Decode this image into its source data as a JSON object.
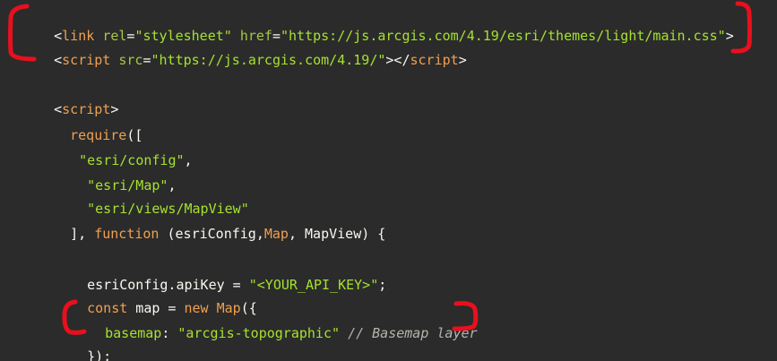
{
  "code": {
    "line1": {
      "open": "<",
      "tag": "link",
      "attr1": "rel",
      "eq1": "=",
      "val1": "\"stylesheet\"",
      "attr2": "href",
      "eq2": "=",
      "val2": "\"https://js.arcgis.com/4.19/esri/themes/light/main.css\"",
      "close": ">"
    },
    "line2": {
      "open": "<",
      "tag": "script",
      "attr1": "src",
      "eq1": "=",
      "val1": "\"https://js.arcgis.com/4.19/\"",
      "mid": "></",
      "tag2": "script",
      "close": ">"
    },
    "line4": {
      "open": "<",
      "tag": "script",
      "close": ">"
    },
    "line5": {
      "fn": "require",
      "punct": "(["
    },
    "line6": {
      "str": "\"esri/config\"",
      "punct": ","
    },
    "line7": {
      "str": "\"esri/Map\"",
      "punct": ","
    },
    "line8": {
      "str": "\"esri/views/MapView\""
    },
    "line9": {
      "p1": "], ",
      "kw": "function",
      "p2": " (esriConfig,",
      "map": "Map",
      "p3": ", MapView) {"
    },
    "line11": {
      "p1": "esriConfig.apiKey = ",
      "str": "\"<YOUR_API_KEY>\"",
      "p2": ";"
    },
    "line12": {
      "kw1": "const",
      "p1": " map = ",
      "kw2": "new",
      "p2": " ",
      "cls": "Map",
      "p3": "({"
    },
    "line13": {
      "prop": "basemap",
      "p1": ": ",
      "str": "\"arcgis-topographic\"",
      "p2": " ",
      "comment": "// Basemap layer"
    },
    "line14": {
      "p1": "});"
    }
  },
  "colors": {
    "background": "#2b2b2b",
    "annotation": "#e8101e"
  }
}
